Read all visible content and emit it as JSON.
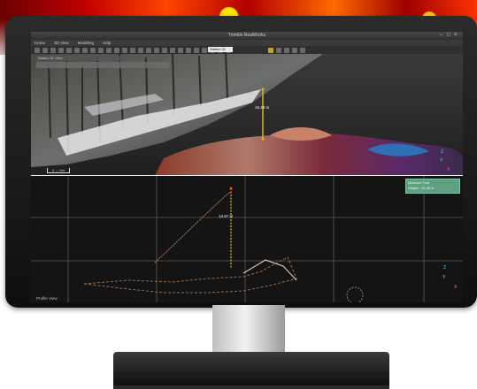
{
  "app": {
    "title": "Trimble RealWorks",
    "window_controls": [
      "–",
      "□",
      "×"
    ]
  },
  "menu": {
    "items": [
      "Home",
      "3D View",
      "Modeling",
      "Help"
    ]
  },
  "toolbar": {
    "select_value": "Station 01"
  },
  "viewport_top": {
    "panel_label": "Station 01 View",
    "height_label": "15.48 m",
    "scale_label": "0 — 5m",
    "axes": {
      "x": "X",
      "y": "Y",
      "z": "Z"
    }
  },
  "viewport_bottom": {
    "info_panel": {
      "title": "Measure Tool",
      "value": "Height : 15.48 m"
    },
    "height_label": "14.57 m",
    "profile_label": "Profile View",
    "axes": {
      "x": "X",
      "y": "Y",
      "z": "Z"
    }
  },
  "colors": {
    "accent_green": "#5f9f82",
    "measure_yellow": "#d7b12a",
    "screen_bg": "#1b1b1b",
    "bezel": "#111111"
  }
}
